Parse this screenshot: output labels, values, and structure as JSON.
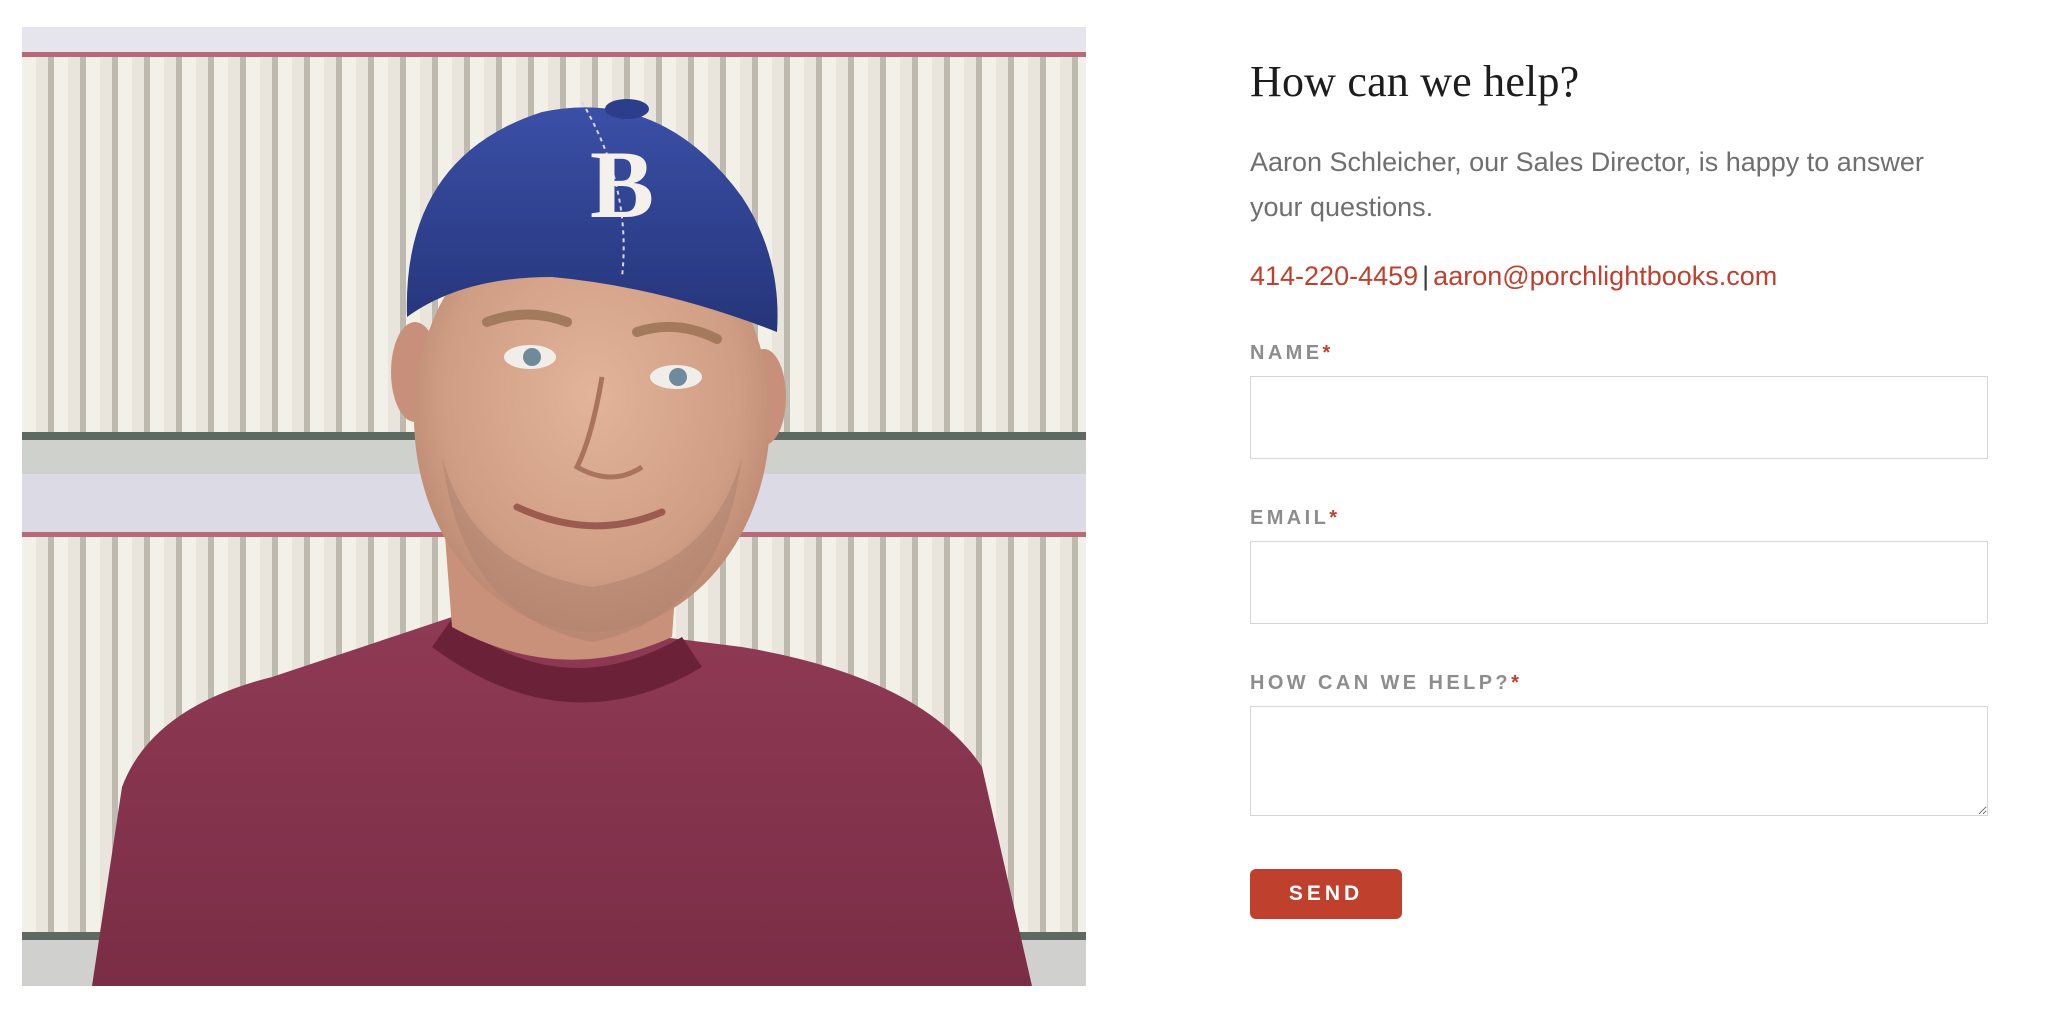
{
  "photo": {
    "cap_letter": "B"
  },
  "contact": {
    "heading": "How can we help?",
    "intro": "Aaron Schleicher, our Sales Director, is happy to answer your questions.",
    "phone": "414-220-4459",
    "separator": "|",
    "email": "aaron@porchlightbooks.com"
  },
  "form": {
    "name_label": "NAME",
    "email_label": "EMAIL",
    "help_label": "HOW CAN WE HELP?",
    "required_mark": "*",
    "name_value": "",
    "email_value": "",
    "help_value": "",
    "send_label": "SEND"
  },
  "colors": {
    "accent": "#c0402e",
    "label": "#8d8d8d",
    "body_text": "#6f6f6f",
    "heading": "#1d1d1d",
    "input_border": "#d6d6d6"
  }
}
